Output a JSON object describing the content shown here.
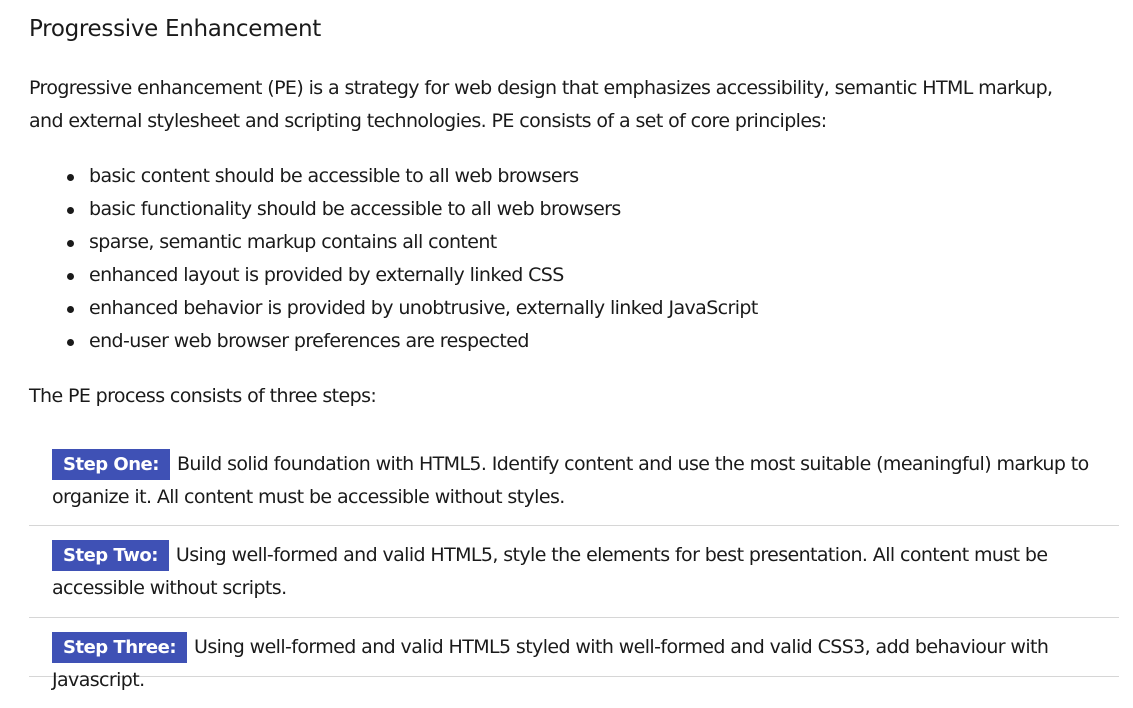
{
  "heading": "Progressive Enhancement",
  "intro": "Progressive enhancement (PE) is a strategy for web design that emphasizes accessibility, semantic HTML markup, and external stylesheet and scripting technologies. PE consists of a set of core principles:",
  "principles": [
    "basic content should be accessible to all web browsers",
    "basic functionality should be accessible to all web browsers",
    "sparse, semantic markup contains all content",
    "enhanced layout is provided by externally linked CSS",
    "enhanced behavior is provided by unobtrusive, externally linked JavaScript",
    "end-user web browser preferences are respected"
  ],
  "process_intro": "The PE process consists of three steps:",
  "steps": [
    {
      "label": "Step One:",
      "text": "Build solid foundation with HTML5. Identify content and use the most suitable (meaningful) markup to organize it. All content must be accessible without styles."
    },
    {
      "label": "Step Two:",
      "text": "Using well-formed and valid HTML5, style the elements for best presentation. All content must be accessible without scripts."
    },
    {
      "label": "Step Three:",
      "text": "Using well-formed and valid HTML5 styled with well-formed and valid CSS3, add behaviour with Javascript."
    }
  ],
  "colors": {
    "badge_background": "#3f51b5",
    "badge_text": "#ffffff",
    "body_text": "#1a1a1a",
    "divider": "#d6d6d6"
  }
}
